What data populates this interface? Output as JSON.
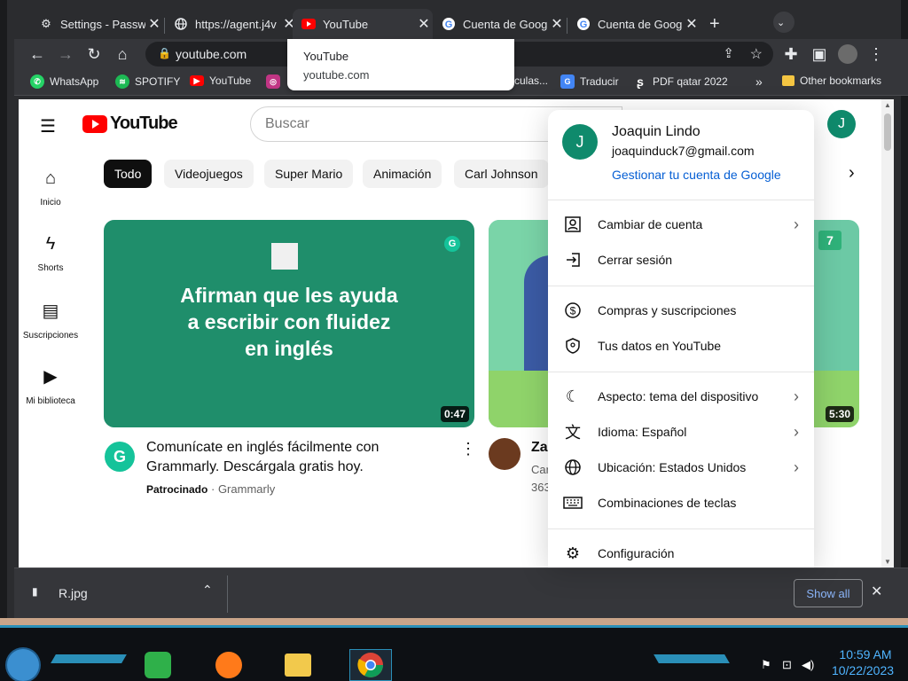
{
  "browser": {
    "tabs": [
      {
        "label": "Settings - Passw",
        "icon": "gear-icon"
      },
      {
        "label": "https://agent.j4v",
        "icon": "globe-icon"
      },
      {
        "label": "YouTube",
        "icon": "youtube-icon",
        "active": true
      },
      {
        "label": "Cuenta de Goog",
        "icon": "google-icon"
      },
      {
        "label": "Cuenta de Goog",
        "icon": "google-icon"
      }
    ],
    "url": "youtube.com",
    "tooltip": {
      "title": "YouTube",
      "domain": "youtube.com"
    },
    "bookmarks": [
      {
        "label": "WhatsApp",
        "color": "#25d366",
        "glyph": "W"
      },
      {
        "label": "SPOTIFY",
        "color": "#1db954",
        "glyph": "S"
      },
      {
        "label": "YouTube",
        "color": "#ff0000",
        "glyph": "▶"
      },
      {
        "label": "culas...",
        "color": "#5f6368",
        "glyph": ""
      },
      {
        "label": "Traducir",
        "color": "#4285f4",
        "glyph": "G"
      },
      {
        "label": "PDF qatar 2022",
        "color": "#35363a",
        "glyph": "S"
      }
    ],
    "other_bookmarks": "Other bookmarks",
    "download": {
      "filename": "R.jpg",
      "show_all": "Show all"
    }
  },
  "youtube": {
    "logo": "YouTube",
    "search_placeholder": "Buscar",
    "avatar_letter": "J",
    "sidebar": [
      {
        "label": "Inicio",
        "icon": "home-icon"
      },
      {
        "label": "Shorts",
        "icon": "shorts-icon"
      },
      {
        "label": "Suscripciones",
        "icon": "subscriptions-icon"
      },
      {
        "label": "Mi biblioteca",
        "icon": "library-icon"
      }
    ],
    "chips": [
      "Todo",
      "Videojuegos",
      "Super Mario",
      "Animación",
      "Carl Johnson"
    ],
    "videos": [
      {
        "thumb_text": "Afirman que les ayuda\na escribir con fluidez\nen inglés",
        "duration": "0:47",
        "title": "Comunícate en inglés fácilmente con Grammarly. Descárgala gratis hoy.",
        "sponsored": "Patrocinado",
        "channel": "Grammarly"
      },
      {
        "duration": "5:30",
        "title_partial": "Za",
        "meta1": "Car",
        "meta2": "363"
      }
    ]
  },
  "account_menu": {
    "name": "Joaquin Lindo",
    "email": "joaquinduck7@gmail.com",
    "manage": "Gestionar tu cuenta de Google",
    "avatar_letter": "J",
    "items": [
      {
        "label": "Cambiar de cuenta",
        "icon": "switch-account-icon",
        "chevron": true
      },
      {
        "label": "Cerrar sesión",
        "icon": "sign-out-icon",
        "chevron": false
      },
      {
        "label": "Compras y suscripciones",
        "icon": "dollar-icon",
        "chevron": false
      },
      {
        "label": "Tus datos en YouTube",
        "icon": "shield-user-icon",
        "chevron": false
      },
      {
        "label": "Aspecto: tema del dispositivo",
        "icon": "moon-icon",
        "chevron": true
      },
      {
        "label": "Idioma: Español",
        "icon": "translate-icon",
        "chevron": true
      },
      {
        "label": "Ubicación: Estados Unidos",
        "icon": "globe-icon",
        "chevron": true
      },
      {
        "label": "Combinaciones de teclas",
        "icon": "keyboard-icon",
        "chevron": false
      },
      {
        "label": "Configuración",
        "icon": "settings-icon",
        "chevron": false
      }
    ]
  },
  "taskbar": {
    "time": "10:59 AM",
    "date": "10/22/2023"
  },
  "colors": {
    "youtube_red": "#ff0000",
    "avatar_green": "#0f8a6c",
    "link_blue": "#065fd4",
    "grammarly_green": "#1f8e6b"
  }
}
